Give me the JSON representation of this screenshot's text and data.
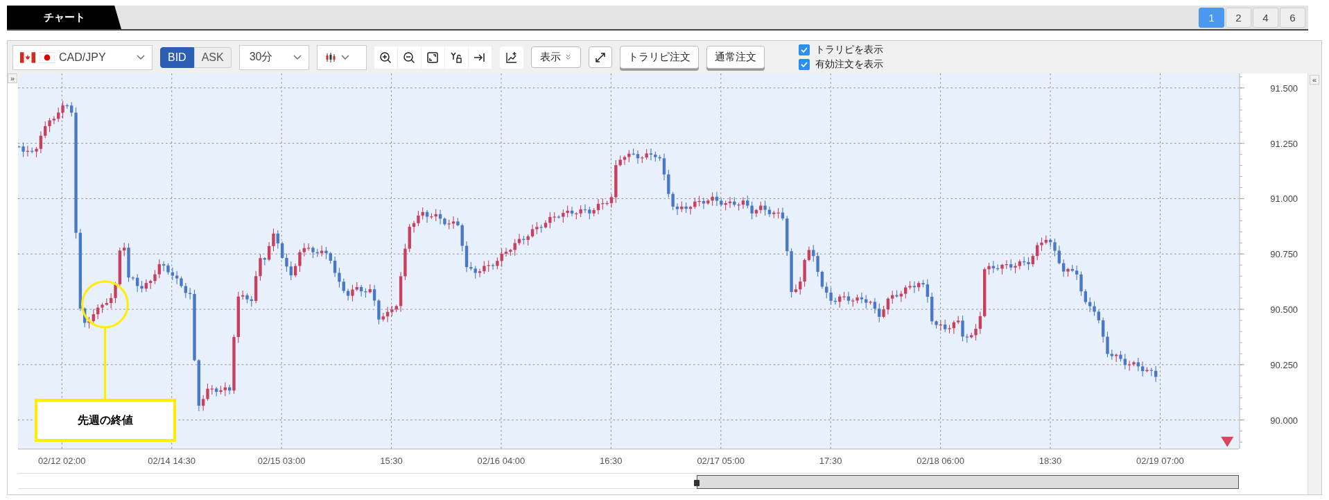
{
  "tabs": [
    {
      "label": "チャート",
      "selected": true
    }
  ],
  "layout_buttons": [
    {
      "label": "1",
      "selected": true
    },
    {
      "label": "2",
      "selected": false
    },
    {
      "label": "4",
      "selected": false
    },
    {
      "label": "6",
      "selected": false
    }
  ],
  "toolbar": {
    "pair": "CAD/JPY",
    "price_side": [
      {
        "label": "BID",
        "selected": true
      },
      {
        "label": "ASK",
        "selected": false
      }
    ],
    "timeframe": "30分",
    "display_button": "表示",
    "order_buttons": [
      "トラリピ注文",
      "通常注文"
    ],
    "checkboxes": [
      {
        "label": "トラリピを表示",
        "checked": true
      },
      {
        "label": "有効注文を表示",
        "checked": true
      }
    ]
  },
  "chart": {
    "collapse_left": "»",
    "collapse_right": "«",
    "price_labels": [
      "91.500",
      "91.250",
      "91.000",
      "90.750",
      "90.500",
      "90.250",
      "90.000"
    ],
    "time_labels": [
      "02/12 02:00",
      "02/14 14:30",
      "02/15 03:00",
      "15:30",
      "02/16 04:00",
      "16:30",
      "02/17 05:00",
      "17:30",
      "02/18 06:00",
      "18:30",
      "02/19 07:00"
    ],
    "callout": "先週の終値"
  }
}
